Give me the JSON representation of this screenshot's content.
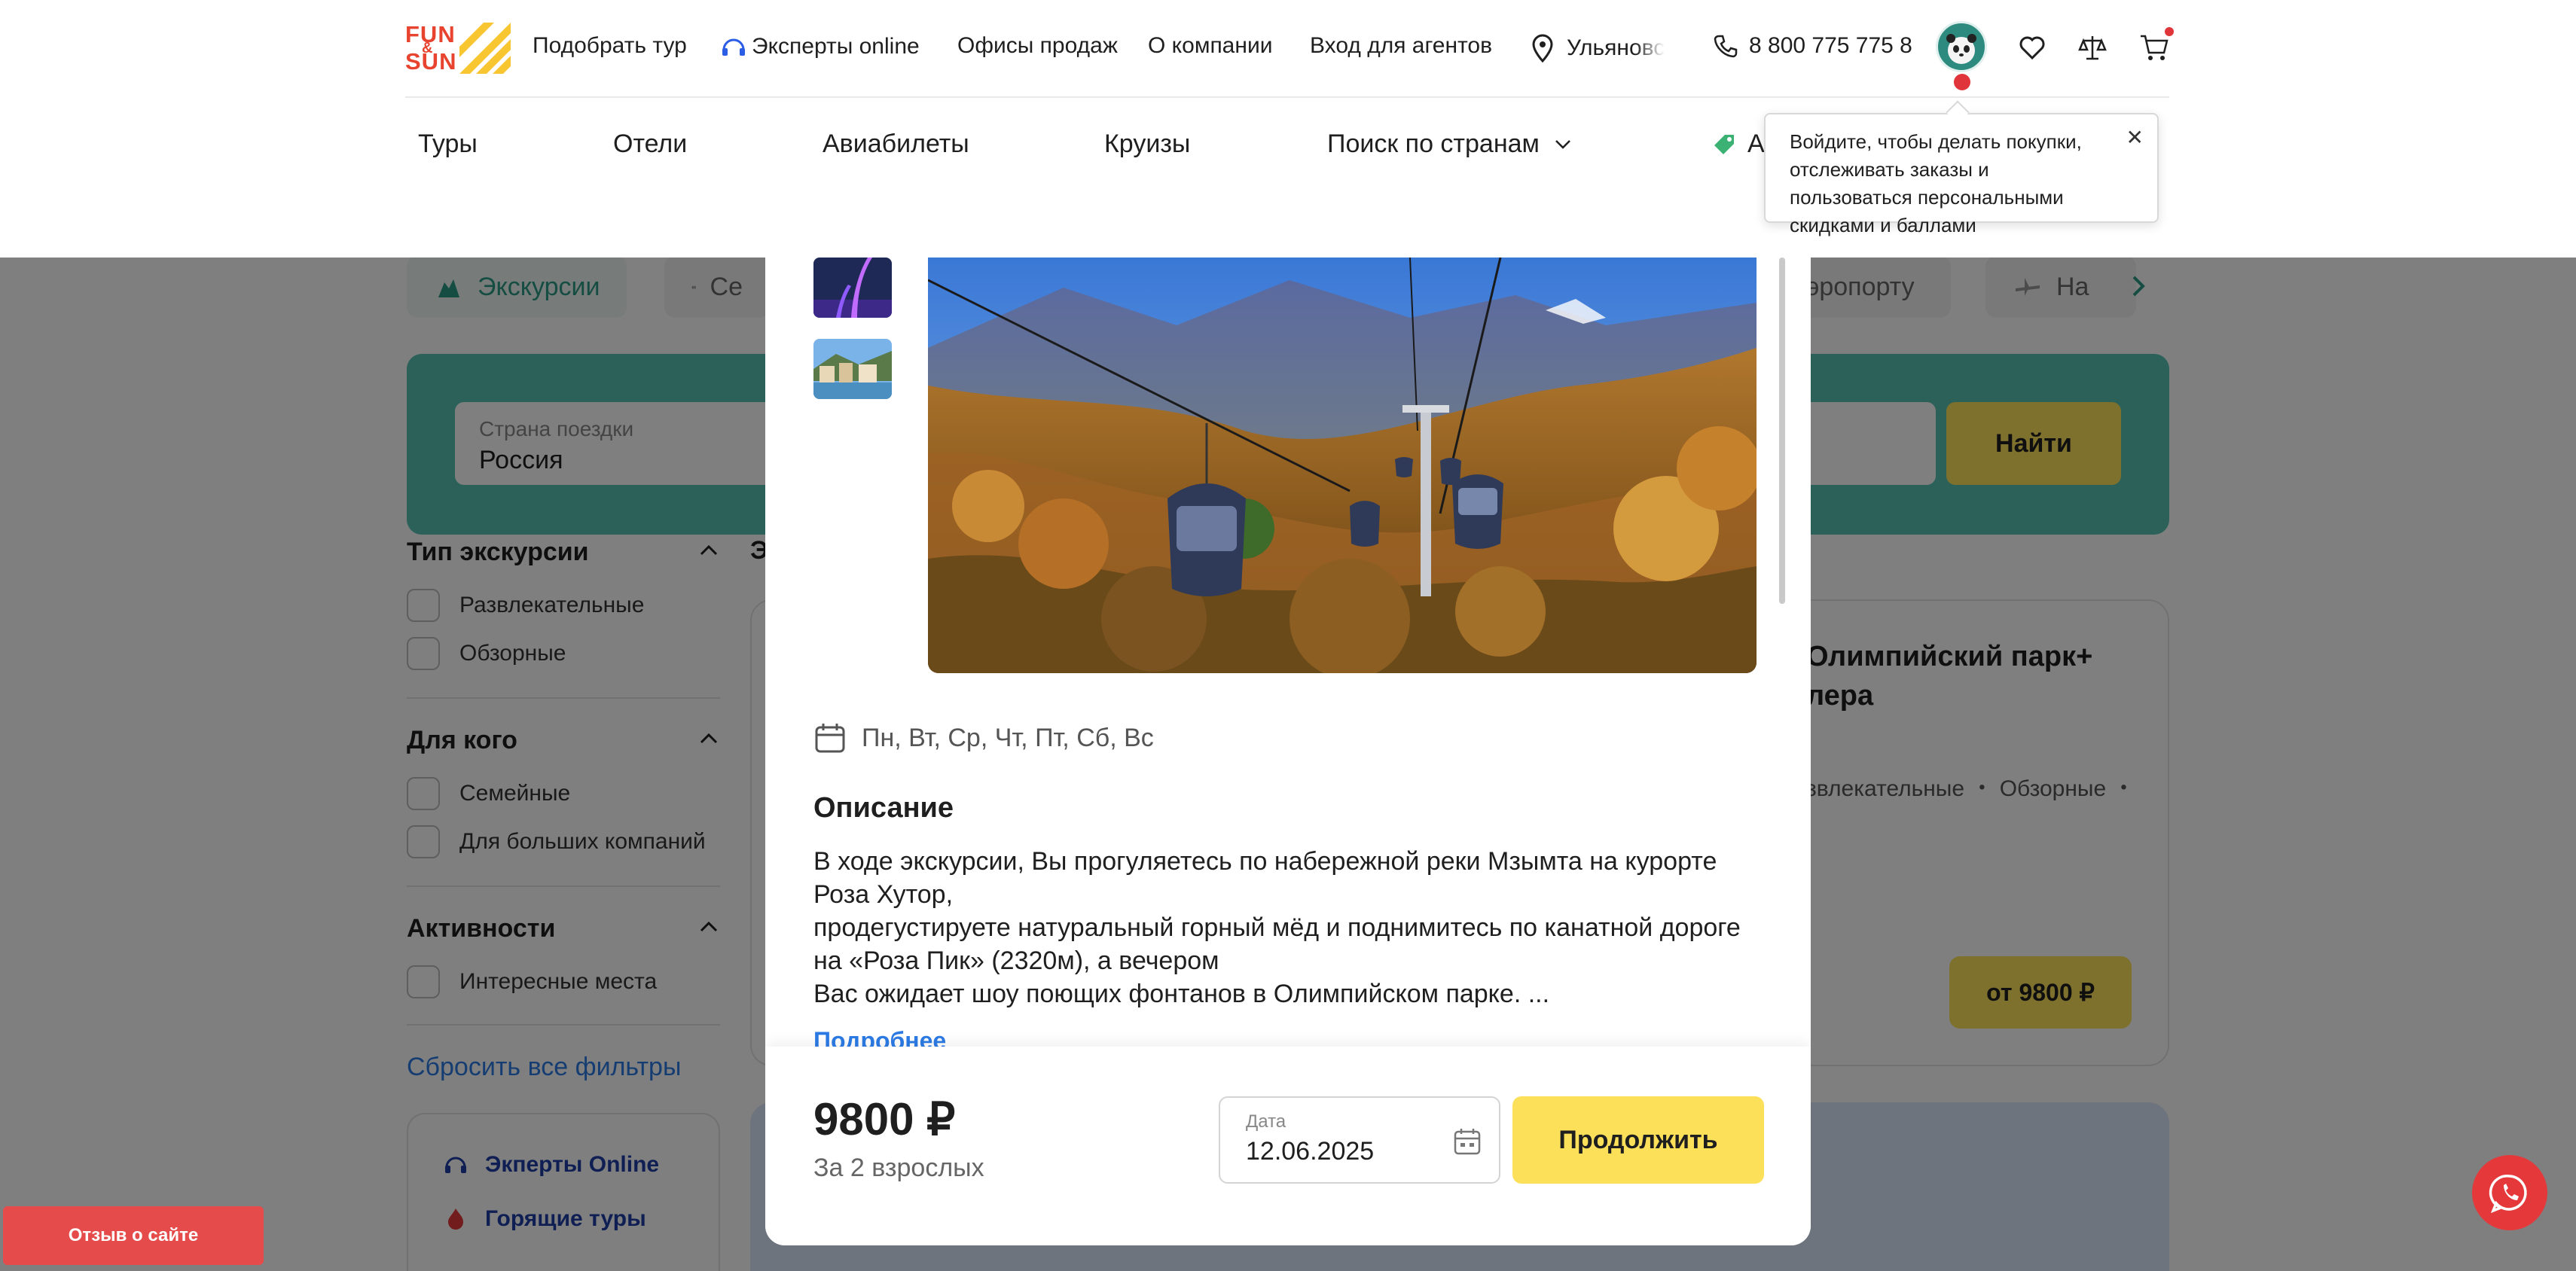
{
  "brand": {
    "logo_top": "FUN",
    "logo_amp": "&",
    "logo_bottom": "SUN",
    "accent_color": "#fce05a",
    "teal_color": "#57c2b2",
    "link_color": "#2c7be5"
  },
  "top_nav": {
    "pick_tour": "Подобрать тур",
    "experts_online": "Эксперты online",
    "sales_offices": "Офисы продаж",
    "about": "О компании",
    "agents_login": "Вход для агентов",
    "city": "Ульяновс",
    "phone": "8 800 775 775 8"
  },
  "main_nav": {
    "tours": "Туры",
    "hotels": "Отели",
    "flights": "Авиабилеты",
    "cruises": "Круизы",
    "country_search": "Поиск по странам",
    "promo_partial": "А"
  },
  "tooltip": {
    "text": "Войдите, чтобы делать покупки, отслеживать заказы и пользоваться персональными скидками и баллами"
  },
  "categories": {
    "excursions": "Экскурсии",
    "certificates_partial": "Се",
    "airport_partial": "эропорту",
    "na_partial": "На"
  },
  "search": {
    "country_label": "Страна поездки",
    "country_value": "Россия",
    "find_button": "Найти"
  },
  "filters": {
    "excursion_type": {
      "title": "Тип экскурсии",
      "options": [
        "Развлекательные",
        "Обзорные"
      ]
    },
    "for_whom": {
      "title": "Для кого",
      "options": [
        "Семейные",
        "Для больших компаний"
      ]
    },
    "activities": {
      "title": "Активности",
      "options": [
        "Интересные места"
      ]
    },
    "reset": "Сбросить все фильтры"
  },
  "help_card": {
    "experts": "Экперты Online",
    "hot_tours": "Горящие туры"
  },
  "background_card": {
    "section_partial": "Э",
    "title": "Олимпийский парк+\nлера",
    "tags": "звлекательные ・ Обзорные ・",
    "price_button": "от 9800 ₽"
  },
  "modal": {
    "days": "Пн, Вт, Ср, Чт, Пт, Сб, Вс",
    "description_title": "Описание",
    "description_lines": [
      "В ходе экскурсии, Вы прогуляетесь по набережной реки Мзымта на курорте",
      "Роза Хутор,",
      "продегустируете натуральный горный мёд и поднимитесь по канатной дороге",
      "на «Роза Пик» (2320м),  а вечером",
      "Вас ожидает шоу поющих фонтанов в Олимпийском парке. ..."
    ],
    "more_link": "Подробнее",
    "price": "9800 ₽",
    "price_note": "За 2 взрослых",
    "date_label": "Дата",
    "date_value": "12.06.2025",
    "continue_button": "Продолжить"
  },
  "feedback_button": "Отзыв о сайте"
}
